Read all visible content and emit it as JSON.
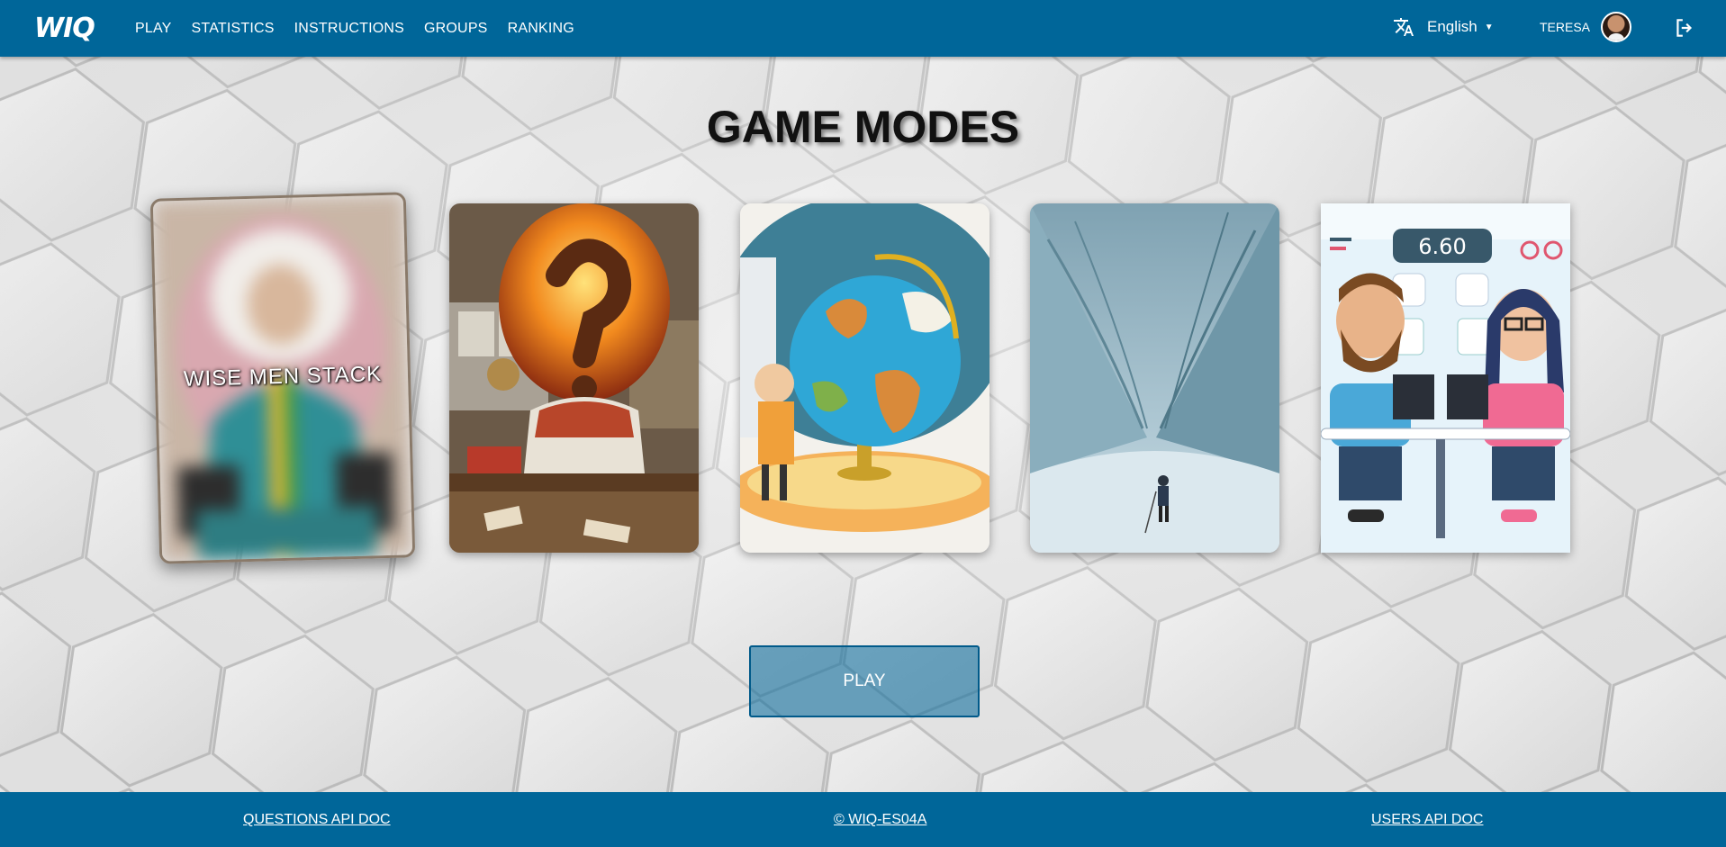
{
  "header": {
    "logo": "WIQ",
    "nav": [
      "PLAY",
      "STATISTICS",
      "INSTRUCTIONS",
      "GROUPS",
      "RANKING"
    ],
    "language": "English",
    "username": "TERESA"
  },
  "main": {
    "title": "GAME MODES",
    "selected_mode_label": "WISE MEN STACK",
    "play_button": "PLAY"
  },
  "footer": {
    "left_link": "QUESTIONS API DOC",
    "center_link": "© WIQ-ES04A",
    "right_link": "USERS API DOC"
  },
  "colors": {
    "primary": "#006699",
    "play_button": "#5b9abb"
  },
  "icons": {
    "language": "translate-icon",
    "dropdown": "caret-down-icon",
    "logout": "logout-icon"
  }
}
